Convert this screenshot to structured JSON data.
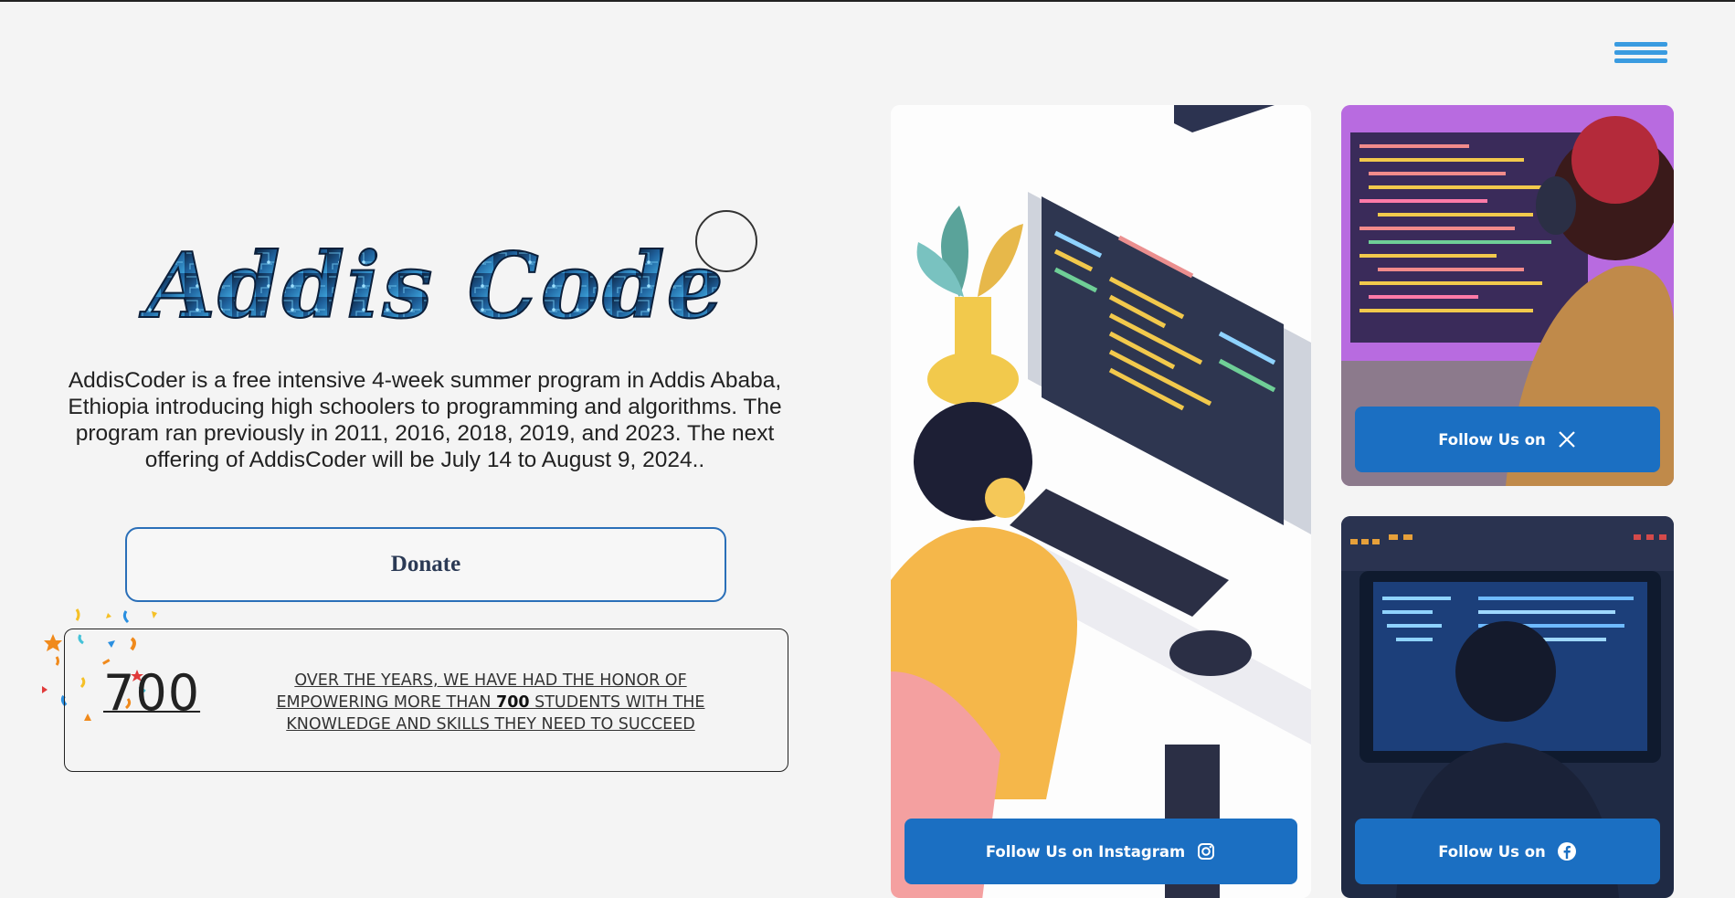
{
  "header": {
    "menu_icon": "hamburger-menu-icon"
  },
  "hero": {
    "logo_text": "Addis Coder",
    "description": "AddisCoder is a free intensive 4-week summer program in Addis Ababa, Ethiopia introducing high schoolers to programming and algorithms. The program ran previously in 2011, 2016, 2018, 2019, and 2023. The next offering of AddisCoder will be July 14 to August 9, 2024..",
    "donate_label": "Donate"
  },
  "stats": {
    "number": "700",
    "text_before": "OVER THE YEARS, WE HAVE HAD THE HONOR OF EMPOWERING MORE THAN ",
    "text_bold": "700",
    "text_after": " STUDENTS WITH THE KNOWLEDGE AND SKILLS THEY NEED TO SUCCEED"
  },
  "social": {
    "instagram_label": "Follow Us on Instagram",
    "x_label": "Follow Us on",
    "facebook_label": "Follow Us on"
  },
  "colors": {
    "accent_blue": "#1b6fc2",
    "menu_blue": "#3a9be0",
    "donate_border": "#2a6fb8",
    "background": "#f4f4f4"
  }
}
